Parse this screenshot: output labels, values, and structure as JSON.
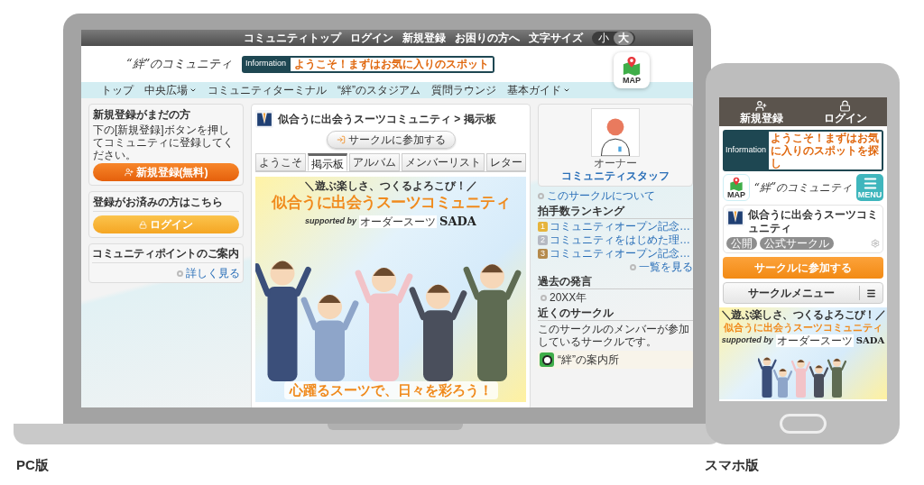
{
  "pc": {
    "label": "PC版",
    "top_links": [
      "コミュニティトップ",
      "ログイン",
      "新規登録",
      "お困りの方へ"
    ],
    "font_size": {
      "label": "文字サイズ",
      "options": [
        {
          "label": "小",
          "selected": false
        },
        {
          "label": "大",
          "selected": true
        }
      ]
    },
    "logo": "“絆”のコミュニティ",
    "information": {
      "label": "Information",
      "message": "ようこそ！まずはお気に入りのスポット"
    },
    "map_label": "MAP",
    "nav": [
      {
        "label": "トップ",
        "dropdown": false
      },
      {
        "label": "中央広場",
        "dropdown": true
      },
      {
        "label": "コミュニティターミナル",
        "dropdown": false
      },
      {
        "label": "“絆”のスタジアム",
        "dropdown": false
      },
      {
        "label": "質問ラウンジ",
        "dropdown": false
      },
      {
        "label": "基本ガイド",
        "dropdown": true
      }
    ],
    "signup": {
      "title": "新規登録がまだの方",
      "text": "下の[新規登録]ボタンを押してコミュニティに登録してください。",
      "button": "新規登録(無料)"
    },
    "login": {
      "title": "登録がお済みの方はこちら",
      "button": "ログイン"
    },
    "points": {
      "title": "コミュニティポイントのご案内",
      "link": "詳しく見る"
    },
    "circle": {
      "breadcrumb": "似合うに出会うスーツコミュニティ > 掲示板",
      "join_button": "サークルに参加する",
      "tabs": [
        {
          "label": "ようこそ",
          "selected": false
        },
        {
          "label": "掲示板",
          "selected": true
        },
        {
          "label": "アルバム",
          "selected": false
        },
        {
          "label": "メンバーリスト",
          "selected": false
        },
        {
          "label": "レター",
          "selected": false
        }
      ],
      "banner": {
        "tagline": "＼遊ぶ楽しさ、つくるよろこび！／",
        "title": "似合うに出会うスーツコミュニティ",
        "supported_by": "supported by",
        "sponsor_sub": "オーダースーツ",
        "sponsor": "SADA",
        "slogan": "心躍るスーツで、日々を彩ろう！"
      }
    },
    "owner": {
      "role": "オーナー",
      "name": "コミュニティスタッフ"
    },
    "about_link": "このサークルについて",
    "ranking": {
      "title": "拍手数ランキング",
      "items": [
        {
          "rank": "1",
          "title": "コミュニティオープン記念…",
          "color": "#e6b43c"
        },
        {
          "rank": "2",
          "title": "コミュニティをはじめた理…",
          "color": "#b5b9c2"
        },
        {
          "rank": "3",
          "title": "コミュニティオープン記念…",
          "color": "#b58a4c"
        }
      ],
      "more": "一覧を見る"
    },
    "past": {
      "title": "過去の発言",
      "items": [
        "20XX年"
      ]
    },
    "nearby": {
      "title": "近くのサークル",
      "text": "このサークルのメンバーが参加しているサークルです。",
      "items": [
        "“絆”の案内所"
      ]
    }
  },
  "sp": {
    "label": "スマホ版",
    "header": [
      {
        "label": "新規登録",
        "kind": "signup"
      },
      {
        "label": "ログイン",
        "kind": "login"
      }
    ],
    "information": {
      "label": "Information",
      "message": "ようこそ！まずはお気に入りのスポットを探し"
    },
    "map_label": "MAP",
    "logo": "“絆”のコミュニティ",
    "menu_label": "MENU",
    "circle": {
      "title": "似合うに出会うスーツコミュニティ",
      "tags": [
        "公開",
        "公式サークル"
      ]
    },
    "join_button": "サークルに参加する",
    "menu_button": "サークルメニュー",
    "banner": {
      "tagline": "＼遊ぶ楽しさ、つくるよろこび！／",
      "title": "似合うに出会うスーツコミュニティ",
      "supported_by": "supported by",
      "sponsor_sub": "オーダースーツ",
      "sponsor": "SADA"
    }
  }
}
